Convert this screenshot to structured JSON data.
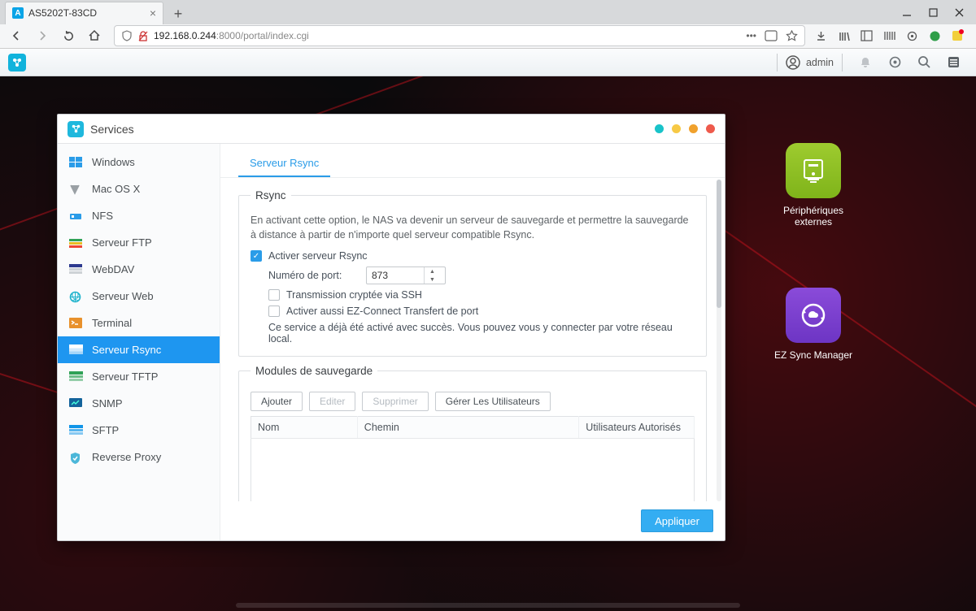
{
  "browser": {
    "tab_title": "AS5202T-83CD",
    "url_prefix": "192.168.0.244",
    "url_suffix": ":8000/portal/index.cgi"
  },
  "portal": {
    "user": "admin"
  },
  "desktop_icons": {
    "peripherals": "Périphériques externes",
    "ezsync": "EZ Sync Manager"
  },
  "window": {
    "title": "Services",
    "sidebar": [
      "Windows",
      "Mac OS X",
      "NFS",
      "Serveur FTP",
      "WebDAV",
      "Serveur Web",
      "Terminal",
      "Serveur Rsync",
      "Serveur TFTP",
      "SNMP",
      "SFTP",
      "Reverse Proxy"
    ],
    "active_index": 7,
    "subtab": "Serveur Rsync",
    "rsync": {
      "legend": "Rsync",
      "description": "En activant cette option, le NAS va devenir un serveur de sauvegarde et permettre la sauvegarde à distance à partir de n'importe quel serveur compatible Rsync.",
      "enable_label": "Activer serveur Rsync",
      "port_label": "Numéro de port:",
      "port_value": "873",
      "ssh_label": "Transmission cryptée via SSH",
      "ezconnect_label": "Activer aussi EZ-Connect Transfert de port",
      "status_msg": "Ce service a déjà été activé avec succès. Vous pouvez vous y connecter par votre réseau local."
    },
    "modules": {
      "legend": "Modules de sauvegarde",
      "buttons": {
        "add": "Ajouter",
        "edit": "Editer",
        "delete": "Supprimer",
        "users": "Gérer Les Utilisateurs"
      },
      "columns": {
        "name": "Nom",
        "path": "Chemin",
        "auth": "Utilisateurs Autorisés"
      }
    },
    "apply_label": "Appliquer"
  }
}
